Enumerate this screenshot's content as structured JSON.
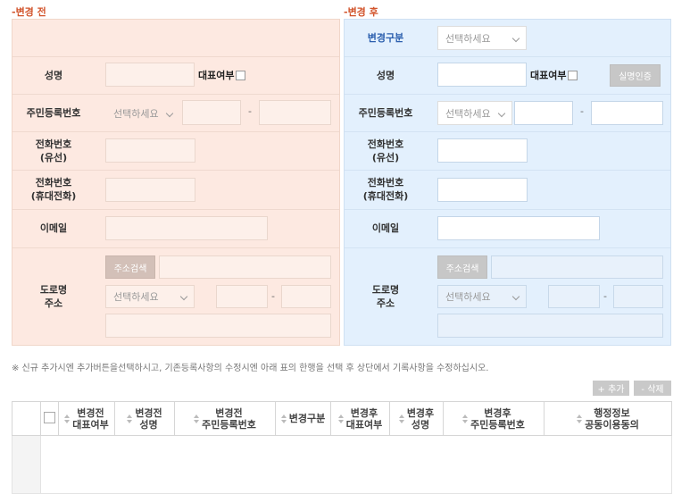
{
  "before": {
    "title": "-변경 전",
    "name_label": "성명",
    "rep_label": "대표여부",
    "rrn_label": "주민등록번호",
    "rrn_select": "선택하세요",
    "rrn_dash": "-",
    "phone_label_1": "전화번호",
    "phone_label_2": "(유선)",
    "mobile_label_1": "전화번호",
    "mobile_label_2": "(휴대전화)",
    "email_label": "이메일",
    "addr_label_1": "도로명",
    "addr_label_2": "주소",
    "addr_search": "주소검색",
    "addr_select": "선택하세요",
    "addr_dash": "-"
  },
  "after": {
    "title": "-변경 후",
    "change_type_label": "변경구분",
    "change_type_select": "선택하세요",
    "name_label": "성명",
    "rep_label": "대표여부",
    "verify_button": "실명인증",
    "rrn_label": "주민등록번호",
    "rrn_select": "선택하세요",
    "rrn_dash": "-",
    "phone_label_1": "전화번호",
    "phone_label_2": "(유선)",
    "mobile_label_1": "전화번호",
    "mobile_label_2": "(휴대전화)",
    "email_label": "이메일",
    "addr_label_1": "도로명",
    "addr_label_2": "주소",
    "addr_search": "주소검색",
    "addr_select": "선택하세요",
    "addr_dash": "-"
  },
  "notice": "※ 신규 추가시엔 추가버튼을선택하시고, 기존등록사항의 수정시엔 아래 표의 한행을 선택 후 상단에서 기록사항을 수정하십시오.",
  "toolbar": {
    "add": "+ 추가",
    "delete": "- 삭제"
  },
  "table": {
    "headers": [
      [
        "변경전",
        "대표여부"
      ],
      [
        "변경전",
        "성명"
      ],
      [
        "변경전",
        "주민등록번호"
      ],
      [
        "변경구분",
        ""
      ],
      [
        "변경후",
        "대표여부"
      ],
      [
        "변경후",
        "성명"
      ],
      [
        "변경후",
        "주민등록번호"
      ],
      [
        "행정정보",
        "공동이용동의"
      ]
    ]
  }
}
